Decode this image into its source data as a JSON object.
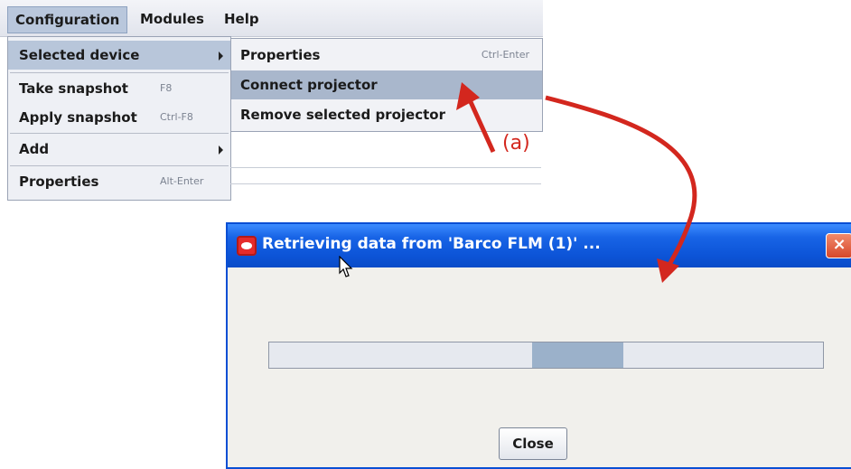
{
  "menubar": {
    "items": [
      {
        "label": "Configuration"
      },
      {
        "label": "Modules"
      },
      {
        "label": "Help"
      }
    ]
  },
  "config_menu": {
    "items": [
      {
        "label": "Selected device"
      },
      {
        "label": "Take snapshot",
        "shortcut": "F8"
      },
      {
        "label": "Apply snapshot",
        "shortcut": "Ctrl-F8"
      },
      {
        "label": "Add"
      },
      {
        "label": "Properties",
        "shortcut": "Alt-Enter"
      }
    ]
  },
  "submenu": {
    "items": [
      {
        "label": "Properties",
        "shortcut": "Ctrl-Enter"
      },
      {
        "label": "Connect projector"
      },
      {
        "label": "Remove selected projector"
      }
    ]
  },
  "callout": {
    "label": "(a)",
    "color": "#d3271e"
  },
  "dialog": {
    "title": "Retrieving data from 'Barco FLM (1)' ...",
    "close_x": "×",
    "progress_fraction": 0.165,
    "close_button": "Close"
  },
  "colors": {
    "titlebar": "#0d55d8",
    "highlight": "#b8c6da",
    "arrow": "#d3271e"
  }
}
